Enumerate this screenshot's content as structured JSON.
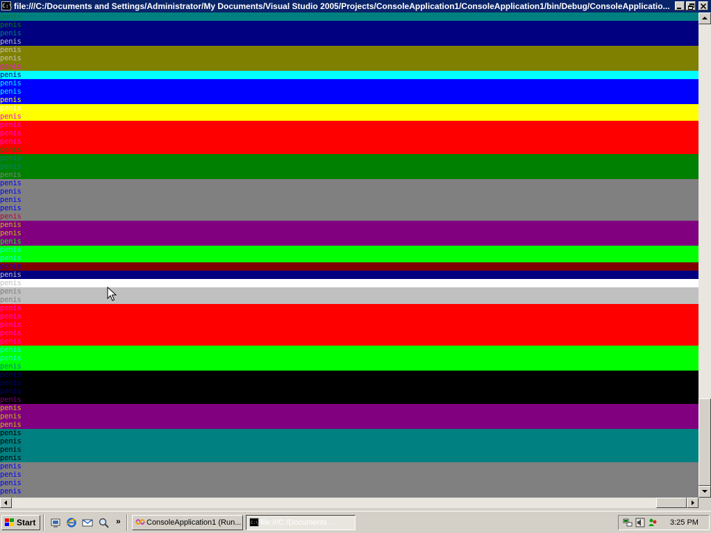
{
  "window": {
    "title": "file:///C:/Documents and Settings/Administrator/My Documents/Visual Studio 2005/Projects/ConsoleApplication1/ConsoleApplication1/bin/Debug/ConsoleApplicatio...",
    "icon_text": "C:\\"
  },
  "console": {
    "word": "penis",
    "rows": [
      {
        "bg": "#008080",
        "fg": "#0a7a3a"
      },
      {
        "bg": "#000080",
        "fg": "#008000"
      },
      {
        "bg": "#000080",
        "fg": "#008080"
      },
      {
        "bg": "#000080",
        "fg": "#c0c0c0"
      },
      {
        "bg": "#808000",
        "fg": "#c0c0c0"
      },
      {
        "bg": "#808000",
        "fg": "#c0c0c0"
      },
      {
        "bg": "#808000",
        "fg": "#ff00ff"
      },
      {
        "bg": "#00ffff",
        "fg": "#000080"
      },
      {
        "bg": "#0000ff",
        "fg": "#00ffff"
      },
      {
        "bg": "#0000ff",
        "fg": "#00ffff"
      },
      {
        "bg": "#0000ff",
        "fg": "#ffff00"
      },
      {
        "bg": "#ffff00",
        "fg": "#ffffff"
      },
      {
        "bg": "#ffff00",
        "fg": "#ff00ff"
      },
      {
        "bg": "#ff0000",
        "fg": "#ff00ff"
      },
      {
        "bg": "#ff0000",
        "fg": "#ff00ff"
      },
      {
        "bg": "#ff0000",
        "fg": "#ff00ff"
      },
      {
        "bg": "#ff0000",
        "fg": "#008000"
      },
      {
        "bg": "#008000",
        "fg": "#008080"
      },
      {
        "bg": "#008000",
        "fg": "#008080"
      },
      {
        "bg": "#008000",
        "fg": "#808080"
      },
      {
        "bg": "#808080",
        "fg": "#0000ff"
      },
      {
        "bg": "#808080",
        "fg": "#0000ff"
      },
      {
        "bg": "#808080",
        "fg": "#0000ff"
      },
      {
        "bg": "#808080",
        "fg": "#0000ff"
      },
      {
        "bg": "#808080",
        "fg": "#c00040"
      },
      {
        "bg": "#800080",
        "fg": "#c0c000"
      },
      {
        "bg": "#800080",
        "fg": "#c0c000"
      },
      {
        "bg": "#800080",
        "fg": "#00ff00"
      },
      {
        "bg": "#00ff00",
        "fg": "#00ffff"
      },
      {
        "bg": "#00ff00",
        "fg": "#00ffff"
      },
      {
        "bg": "#800000",
        "fg": "#0000ff"
      },
      {
        "bg": "#000080",
        "fg": "#c0c0c0"
      },
      {
        "bg": "#ffffff",
        "fg": "#c0c0c0"
      },
      {
        "bg": "#c0c0c0",
        "fg": "#808080"
      },
      {
        "bg": "#c0c0c0",
        "fg": "#808080"
      },
      {
        "bg": "#ff0000",
        "fg": "#ff00ff"
      },
      {
        "bg": "#ff0000",
        "fg": "#ff00ff"
      },
      {
        "bg": "#ff0000",
        "fg": "#ff00ff"
      },
      {
        "bg": "#ff0000",
        "fg": "#ff00ff"
      },
      {
        "bg": "#ff0000",
        "fg": "#ff00ff"
      },
      {
        "bg": "#00ff00",
        "fg": "#00ffff"
      },
      {
        "bg": "#00ff00",
        "fg": "#00ffff"
      },
      {
        "bg": "#00ff00",
        "fg": "#008080"
      },
      {
        "bg": "#000000",
        "fg": "#000080"
      },
      {
        "bg": "#000000",
        "fg": "#000080"
      },
      {
        "bg": "#000000",
        "fg": "#000080"
      },
      {
        "bg": "#000000",
        "fg": "#800080"
      },
      {
        "bg": "#800080",
        "fg": "#c0c000"
      },
      {
        "bg": "#800080",
        "fg": "#c0c000"
      },
      {
        "bg": "#800080",
        "fg": "#c0c000"
      },
      {
        "bg": "#008080",
        "fg": "#000000"
      },
      {
        "bg": "#008080",
        "fg": "#000000"
      },
      {
        "bg": "#008080",
        "fg": "#000000"
      },
      {
        "bg": "#008080",
        "fg": "#000000"
      },
      {
        "bg": "#808080",
        "fg": "#0000ff"
      },
      {
        "bg": "#808080",
        "fg": "#0000ff"
      },
      {
        "bg": "#808080",
        "fg": "#0000ff"
      },
      {
        "bg": "#808080",
        "fg": "#0000ff"
      },
      {
        "bg": "#808080",
        "fg": "#c0c000"
      }
    ]
  },
  "taskbar": {
    "start_label": "Start",
    "overflow_label": "»",
    "tasks": [
      {
        "label": "ConsoleApplication1 (Run..."
      },
      {
        "label": "file:///C:/Documents ..."
      }
    ],
    "clock": "3:25 PM"
  },
  "colors": {
    "title_bar": "#0a246a",
    "chrome": "#d4d0c8"
  }
}
